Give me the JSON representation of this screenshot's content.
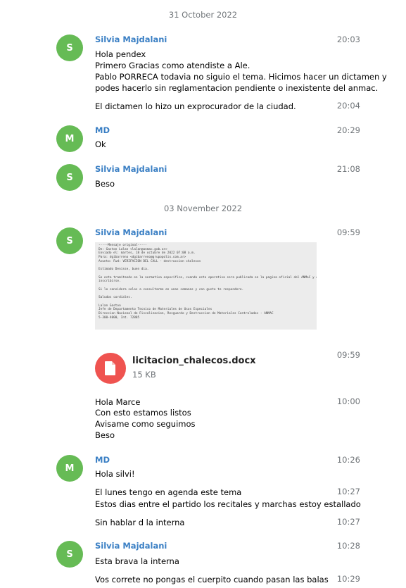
{
  "dates": [
    "31 October 2022",
    "03 November 2022"
  ],
  "groups": [
    {
      "avatar": "S",
      "sender": "Silvia Majdalani",
      "messages": [
        {
          "time": "20:03",
          "lines": [
            "Hola pendex",
            "Primero Gracias como atendiste a Ale.",
            "Pablo PORRECA todavia no siguio el tema. Hicimos hacer un dictamen y",
            "podes hacerlo sin reglamentacion pendiente o inexistente del anmac."
          ]
        },
        {
          "time": "20:04",
          "lines": [
            "El dictamen lo hizo un exprocurador de la ciudad."
          ]
        }
      ]
    },
    {
      "avatar": "M",
      "sender": "MD",
      "messages": [
        {
          "time": "20:29",
          "lines": [
            "Ok"
          ]
        }
      ]
    },
    {
      "avatar": "S",
      "sender": "Silvia Majdalani",
      "messages": [
        {
          "time": "21:08",
          "lines": [
            "Beso"
          ]
        }
      ]
    },
    {
      "avatar": "S",
      "sender": "Silvia Majdalani",
      "image_time": "09:59",
      "image_text": [
        "-----Mensaje original-----",
        "De: Gaston Lalan <lalan@anmac.gob.ar>",
        "Enviado el: martes, 18 de octubre de 2022 07:08 a.m.",
        "Para: dgibarreno <dgibarreno@grupopolix.com.ar>",
        "Asunto: Fwd: VERIFACION DEL CALL - destruccion chalecos",
        "",
        "Estimado Denisse, buen dia.",
        "",
        "Se esta tramitando en la normativa especifica, cuando este operativa sera publicada en la pagina oficial del ANMaC y desde ahi podran",
        "inscribirse.",
        "",
        "Si lo considera solos a consultarme en unas semanas y con gusto te respondere.",
        "",
        "Saludos cordiales.",
        "",
        "Lalan Gaston",
        "Jefe de Departamento Tecnico de Materiales de Usos Especiales",
        "Direccion Nacional de Fiscalizacion, Resguardo y Destruccion de Materiales Controlados - ANMAC",
        "5-300-4000, Int. 72885"
      ],
      "file": {
        "time": "09:59",
        "name": "licitacion_chalecos.docx",
        "size": "15 KB",
        "icon": "document-icon",
        "color": "#ef5350"
      },
      "messages": [
        {
          "time": "10:00",
          "lines": [
            "Hola Marce",
            "Con esto estamos listos",
            "Avisame como seguimos",
            "Beso"
          ]
        }
      ]
    },
    {
      "avatar": "M",
      "sender": "MD",
      "messages": [
        {
          "time": "10:26",
          "lines": [
            "Hola silvi!"
          ]
        },
        {
          "time": "10:27",
          "lines": [
            "El lunes tengo en agenda este tema",
            "Estos dias entre el partido los recitales y marchas estoy estallado"
          ]
        },
        {
          "time": "10:27",
          "lines": [
            "Sin hablar d la interna"
          ]
        }
      ]
    },
    {
      "avatar": "S",
      "sender": "Silvia Majdalani",
      "messages": [
        {
          "time": "10:28",
          "lines": [
            "Esta brava la interna"
          ]
        },
        {
          "time": "10:29",
          "lines": [
            "Vos correte no pongas el cuerpito cuando pasan las balas"
          ]
        }
      ]
    }
  ],
  "colors": {
    "avatar": "#66bb55",
    "sender": "#3a7fc4",
    "muted": "#707579"
  }
}
